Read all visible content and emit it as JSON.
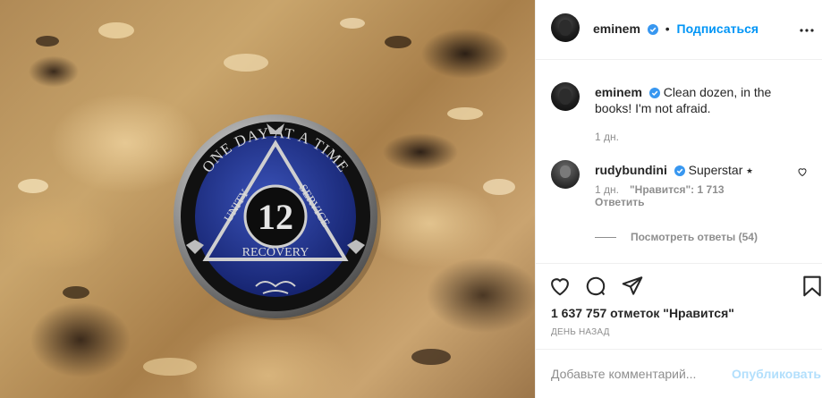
{
  "post": {
    "author": "eminem",
    "follow_label": "Подписаться",
    "caption": {
      "author": "eminem",
      "text": "Clean dozen, in the books! I'm not afraid.",
      "time": "1 дн."
    },
    "comments": [
      {
        "author": "rudybundini",
        "text": "Superstar ⭑",
        "time": "1 дн.",
        "likes_label": "\"Нравится\": 1 713",
        "reply_label": "Ответить"
      }
    ],
    "view_replies_label": "Посмотреть ответы (54)",
    "likes_text": "1 637 757 отметок \"Нравится\"",
    "date_text": "ДЕНЬ НАЗАД",
    "add_comment_placeholder": "Добавьте комментарий...",
    "publish_label": "Опубликовать"
  },
  "coin": {
    "top_text": "ONE DAY AT A TIME",
    "left_text": "UNITY",
    "right_text": "SERVICE",
    "bottom_text": "RECOVERY",
    "number": "12"
  },
  "icons": {
    "verified": "verified-badge-icon",
    "more": "more-horizontal-icon",
    "like": "heart-outline-icon",
    "comment": "comment-bubble-icon",
    "share": "paper-plane-icon",
    "save": "bookmark-icon"
  },
  "colors": {
    "link_blue": "#0095f6",
    "verified_blue": "#3897f0",
    "muted": "#8e8e8e",
    "publish_disabled": "#b2dffc",
    "coin_blue": "#1f2f86"
  }
}
